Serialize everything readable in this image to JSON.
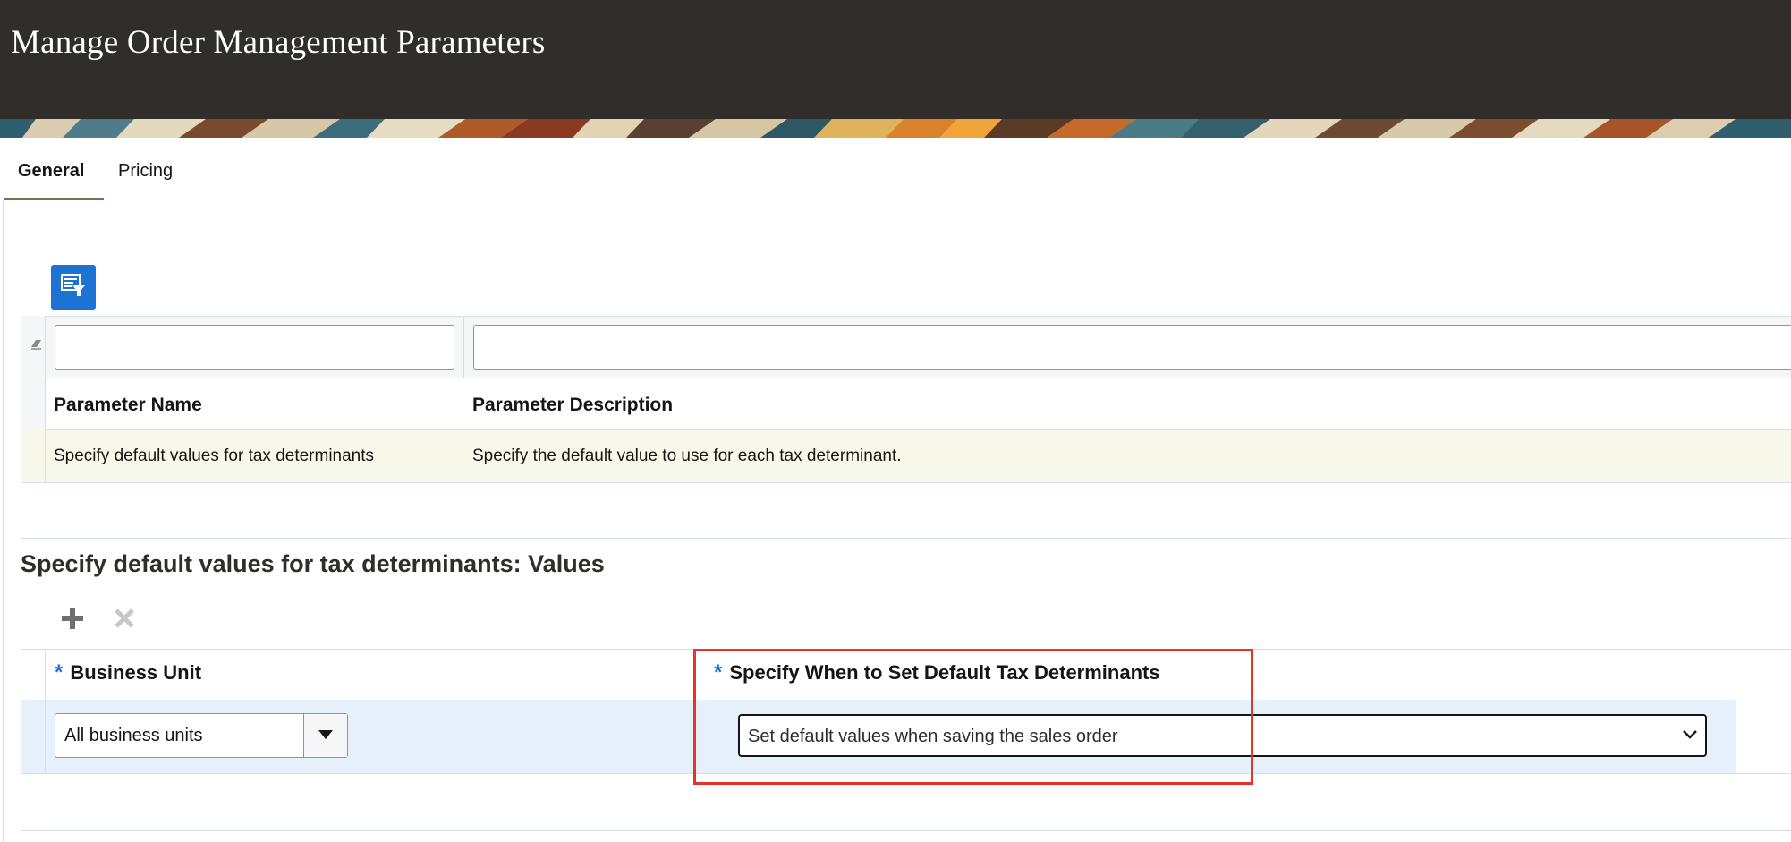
{
  "header": {
    "title": "Manage Order Management Parameters"
  },
  "tabs": [
    {
      "label": "General",
      "selected": true
    },
    {
      "label": "Pricing",
      "selected": false
    }
  ],
  "parameters_table": {
    "filter_name_value": "",
    "filter_description_value": "",
    "columns": [
      "Parameter Name",
      "Parameter Description"
    ],
    "rows": [
      {
        "name": "Specify default values for tax determinants",
        "description": "Specify the default value to use for each tax determinant."
      }
    ]
  },
  "values_section": {
    "title": "Specify default values for tax determinants: Values",
    "required_marker": "*",
    "columns": [
      "Business Unit",
      "Specify When to Set Default Tax Determinants"
    ],
    "rows": [
      {
        "business_unit": "All business units",
        "when": "Set default values when saving the sales order"
      }
    ]
  },
  "colors": {
    "header_bg": "#312d2a",
    "accent_blue": "#1d73d4",
    "selected_row": "#e5f0fb",
    "highlight_box": "#e8322a",
    "tab_underline": "#5f7d4f"
  },
  "icons": {
    "filter_button": "query-by-example-icon",
    "clear_filter": "eraser-icon",
    "add": "plus-icon",
    "delete": "x-icon",
    "combo_dropdown": "triangle-down-icon",
    "select_dropdown": "chevron-down-icon"
  }
}
